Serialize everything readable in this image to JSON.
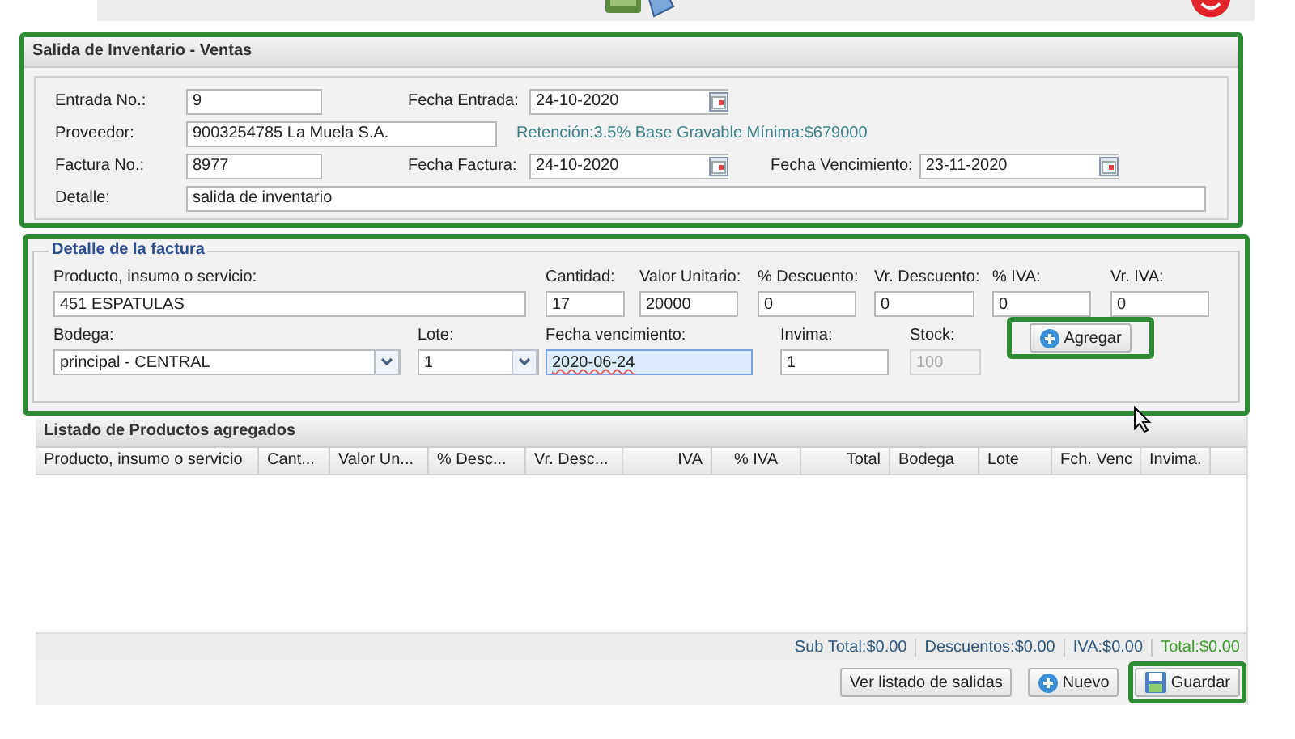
{
  "form": {
    "title": "Salida de Inventario - Ventas",
    "highlighted": true,
    "entrada_no": {
      "label": "Entrada No.:",
      "value": "9"
    },
    "fecha_entrada": {
      "label": "Fecha Entrada:",
      "value": "24-10-2020"
    },
    "proveedor": {
      "label": "Proveedor:",
      "value": "9003254785 La Muela S.A."
    },
    "retencion_note": "Retención:3.5% Base Gravable Mínima:$679000",
    "factura_no": {
      "label": "Factura No.:",
      "value": "8977"
    },
    "fecha_factura": {
      "label": "Fecha Factura:",
      "value": "24-10-2020"
    },
    "fecha_vencimiento": {
      "label": "Fecha Vencimiento:",
      "value": "23-11-2020"
    },
    "detalle": {
      "label": "Detalle:",
      "value": "salida de inventario"
    }
  },
  "invoice_detail": {
    "legend": "Detalle de la factura",
    "highlighted": true,
    "row_1": [
      {
        "label": "Producto, insumo o servicio:",
        "value": "451 ESPATULAS",
        "kind": "text",
        "focused": false,
        "disabled": false
      },
      {
        "label": "Cantidad:",
        "value": "17",
        "kind": "text",
        "focused": false,
        "disabled": false
      },
      {
        "label": "Valor Unitario:",
        "value": "20000",
        "kind": "text",
        "focused": false,
        "disabled": false
      },
      {
        "label": "% Descuento:",
        "value": "0",
        "kind": "text",
        "focused": false,
        "disabled": false
      },
      {
        "label": "Vr. Descuento:",
        "value": "0",
        "kind": "text",
        "focused": false,
        "disabled": false
      },
      {
        "label": "% IVA:",
        "value": "0",
        "kind": "text",
        "focused": false,
        "disabled": false
      },
      {
        "label": "Vr. IVA:",
        "value": "0",
        "kind": "text",
        "focused": false,
        "disabled": false
      }
    ],
    "row_2": [
      {
        "label": "Bodega:",
        "value": "principal - CENTRAL",
        "kind": "select",
        "focused": false,
        "disabled": false
      },
      {
        "label": "Lote:",
        "value": "1",
        "kind": "select",
        "focused": false,
        "disabled": false
      },
      {
        "label": "Fecha vencimiento:",
        "value": "2020-06-24",
        "kind": "text",
        "focused": true,
        "disabled": false
      },
      {
        "label": "Invima:",
        "value": "1",
        "kind": "text",
        "focused": false,
        "disabled": false
      },
      {
        "label": "Stock:",
        "value": "100",
        "kind": "text",
        "focused": false,
        "disabled": true
      }
    ],
    "add_button": {
      "label": "Agregar",
      "highlighted": true
    }
  },
  "products_list": {
    "title": "Listado de Productos agregados",
    "columns": [
      {
        "label": "Producto, insumo o servicio"
      },
      {
        "label": "Cant..."
      },
      {
        "label": "Valor Un..."
      },
      {
        "label": "% Desc..."
      },
      {
        "label": "Vr. Desc..."
      },
      {
        "label": "IVA"
      },
      {
        "label": "% IVA"
      },
      {
        "label": "Total"
      },
      {
        "label": "Bodega"
      },
      {
        "label": "Lote"
      },
      {
        "label": "Fch. Venc"
      },
      {
        "label": "Invima."
      }
    ],
    "totals": [
      {
        "text": "Sub Total:$0.00",
        "kind": "normal"
      },
      {
        "text": "Descuentos:$0.00",
        "kind": "normal"
      },
      {
        "text": "IVA:$0.00",
        "kind": "normal"
      },
      {
        "text": "Total:$0.00",
        "kind": "grand"
      }
    ]
  },
  "buttons": [
    {
      "label": "Ver listado de salidas",
      "highlighted": false
    },
    {
      "label": "Nuevo",
      "highlighted": false
    },
    {
      "label": "Guardar",
      "highlighted": true
    }
  ]
}
